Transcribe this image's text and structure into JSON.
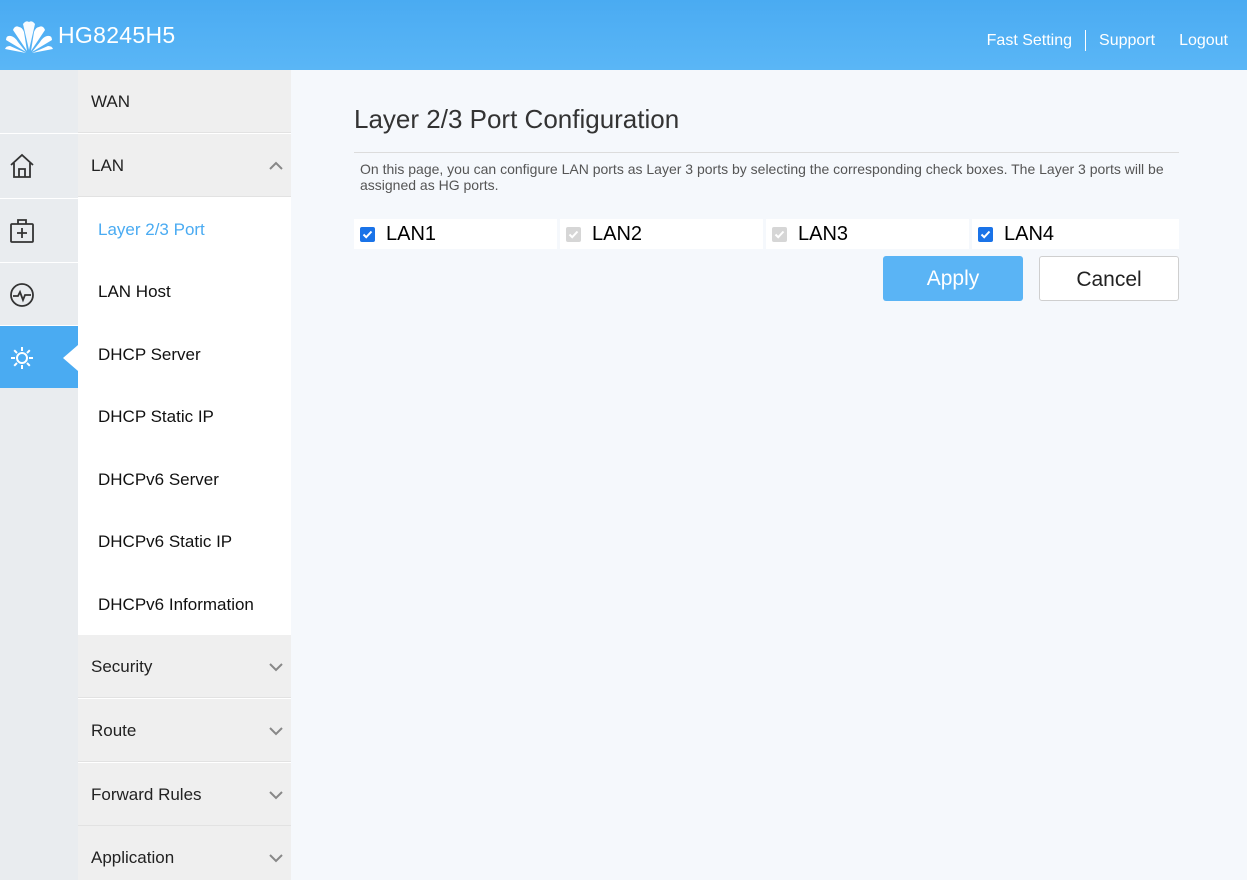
{
  "header": {
    "model": "HG8245H5",
    "links": {
      "fast_setting": "Fast Setting",
      "support": "Support",
      "logout": "Logout"
    }
  },
  "iconbar": {
    "items": [
      "home-icon",
      "add-box-icon",
      "monitor-icon",
      "gear-icon"
    ],
    "active": "gear-icon"
  },
  "menu": {
    "groups_top": [
      {
        "label": "WAN"
      },
      {
        "label": "LAN",
        "expanded": true
      }
    ],
    "lan_items": [
      {
        "label": "Layer 2/3 Port",
        "active": true
      },
      {
        "label": "LAN Host"
      },
      {
        "label": "DHCP Server"
      },
      {
        "label": "DHCP Static IP"
      },
      {
        "label": "DHCPv6 Server"
      },
      {
        "label": "DHCPv6 Static IP"
      },
      {
        "label": "DHCPv6 Information"
      }
    ],
    "groups_bottom": [
      {
        "label": "Security"
      },
      {
        "label": "Route"
      },
      {
        "label": "Forward Rules"
      },
      {
        "label": "Application"
      }
    ]
  },
  "main": {
    "title": "Layer 2/3 Port Configuration",
    "description": "On this page, you can configure LAN ports as Layer 3 ports by selecting the corresponding check boxes. The Layer 3 ports will be assigned as HG ports.",
    "ports": [
      {
        "label": "LAN1",
        "checked": true,
        "disabled": false
      },
      {
        "label": "LAN2",
        "checked": true,
        "disabled": true
      },
      {
        "label": "LAN3",
        "checked": true,
        "disabled": true
      },
      {
        "label": "LAN4",
        "checked": true,
        "disabled": false
      }
    ],
    "apply_label": "Apply",
    "cancel_label": "Cancel"
  },
  "colors": {
    "accent": "#4aabf2",
    "checkbox": "#1a73e8",
    "disabled": "#d6d6d6"
  }
}
